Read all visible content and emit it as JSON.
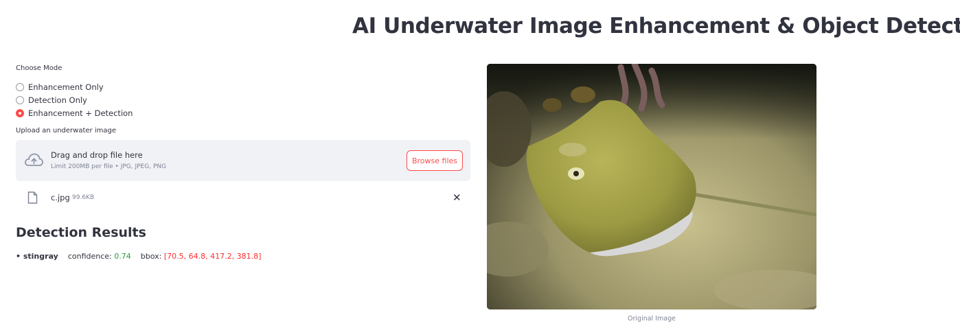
{
  "header": {
    "title": "AI Underwater Image Enhancement & Object Detection"
  },
  "mode": {
    "label": "Choose Mode",
    "options": [
      {
        "label": "Enhancement Only",
        "selected": false
      },
      {
        "label": "Detection Only",
        "selected": false
      },
      {
        "label": "Enhancement + Detection",
        "selected": true
      }
    ]
  },
  "upload": {
    "label": "Upload an underwater image",
    "drop_text": "Drag and drop file here",
    "limit_text": "Limit 200MB per file • JPG, JPEG, PNG",
    "browse_label": "Browse files",
    "file": {
      "name": "c.jpg",
      "size": "99.6KB",
      "remove_icon": "close-icon"
    }
  },
  "results": {
    "title": "Detection Results",
    "items": [
      {
        "bullet": "• stingray",
        "confidence_label": "confidence:",
        "confidence": "0.74",
        "bbox_label": "bbox:",
        "bbox": "[70.5, 64.8, 417.2, 381.8]"
      }
    ]
  },
  "image": {
    "caption": "Original Image",
    "subject": "stingray on sea floor"
  },
  "colors": {
    "accent": "#ff4b4b",
    "confidence": "#21a33a",
    "bbox": "#ff2b2b",
    "text": "#31333f",
    "muted": "#808495",
    "dropzone_bg": "#f0f2f6"
  }
}
